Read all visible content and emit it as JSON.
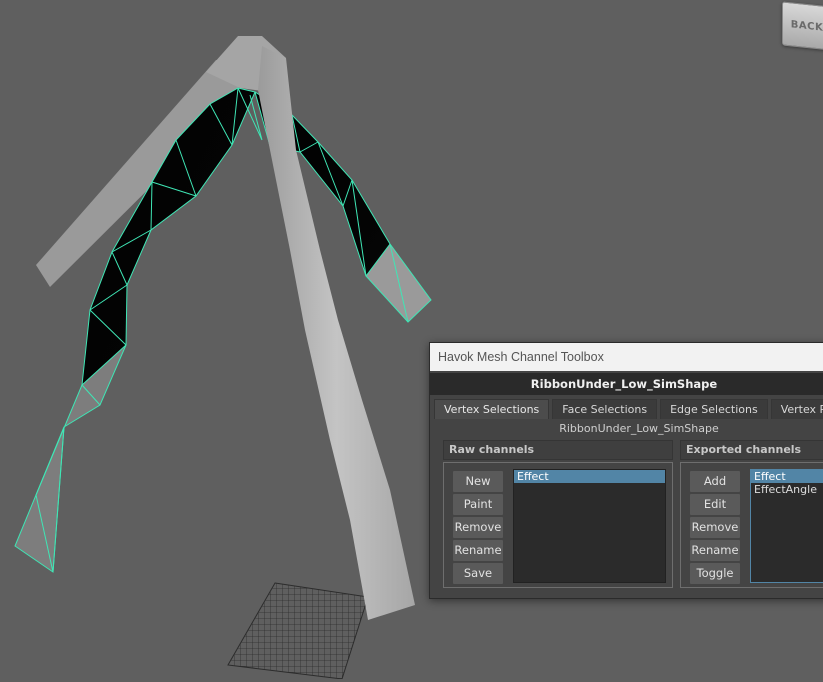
{
  "viewport": {
    "viewcube_label": "BACK",
    "colors": {
      "background": "#5f5f5f",
      "selection_wire": "#3fe6b5",
      "mesh": "#b3b3b3"
    }
  },
  "toolbox": {
    "title": "Havok Mesh Channel Toolbox",
    "shape_name": "RibbonUnder_Low_SimShape",
    "tabs": [
      {
        "label": "Vertex Selections"
      },
      {
        "label": "Face Selections"
      },
      {
        "label": "Edge Selections"
      },
      {
        "label": "Vertex Painti"
      }
    ],
    "current_shape": "RibbonUnder_Low_SimShape",
    "raw_channels": {
      "title": "Raw channels",
      "buttons": [
        "New",
        "Paint",
        "Remove",
        "Rename",
        "Save"
      ],
      "items": [
        "Effect"
      ],
      "selected": "Effect"
    },
    "exported_channels": {
      "title": "Exported channels",
      "buttons": [
        "Add",
        "Edit",
        "Remove",
        "Rename",
        "Toggle"
      ],
      "items": [
        "Effect",
        "EffectAngle"
      ],
      "selected": "Effect"
    }
  }
}
